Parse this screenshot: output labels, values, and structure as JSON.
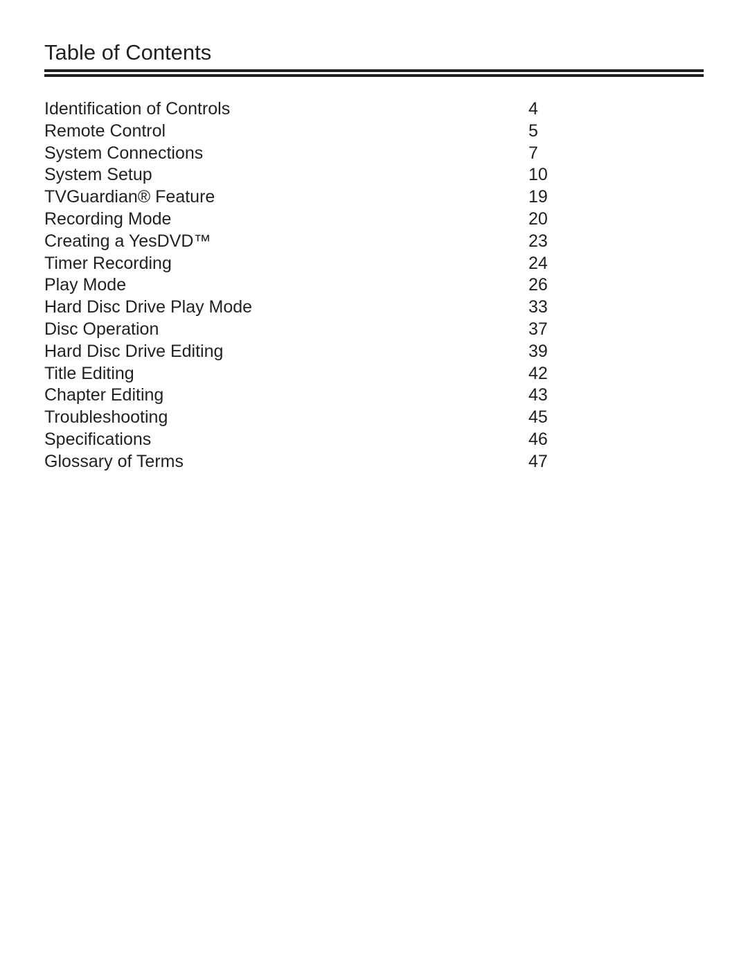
{
  "page": {
    "title": "Table of Contents"
  },
  "toc": {
    "entries": [
      {
        "title": "Identiﬁcation of Controls",
        "page": "4"
      },
      {
        "title": "Remote Control",
        "page": "5"
      },
      {
        "title": "System Connections",
        "page": "7"
      },
      {
        "title": "System Setup",
        "page": "10"
      },
      {
        "title": "TVGuardian® Feature",
        "page": "19"
      },
      {
        "title": "Recording Mode",
        "page": "20"
      },
      {
        "title": "Creating a YesDVD™",
        "page": "23"
      },
      {
        "title": "Timer Recording",
        "page": "24"
      },
      {
        "title": "Play Mode",
        "page": "26"
      },
      {
        "title": "Hard Disc Drive Play Mode",
        "page": "33"
      },
      {
        "title": "Disc Operation",
        "page": "37"
      },
      {
        "title": "Hard Disc Drive Editing",
        "page": "39"
      },
      {
        "title": "Title Editing",
        "page": "42"
      },
      {
        "title": "Chapter Editing",
        "page": "43"
      },
      {
        "title": "Troubleshooting",
        "page": "45"
      },
      {
        "title": "Speciﬁcations",
        "page": "46"
      },
      {
        "title": "Glossary of Terms",
        "page": "47"
      }
    ]
  }
}
